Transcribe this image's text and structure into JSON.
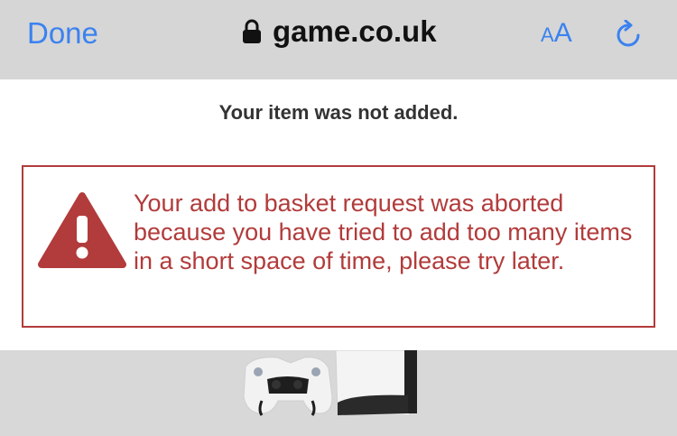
{
  "toolbar": {
    "done_label": "Done",
    "domain": "game.co.uk",
    "text_size_small": "A",
    "text_size_big": "A"
  },
  "page": {
    "heading": "Your item was not added.",
    "alert_message": "Your add to basket request was aborted because you have tried to add too many items in a short space of time, please try later."
  },
  "colors": {
    "link_blue": "#3b82f0",
    "alert_red": "#b23b3b",
    "toolbar_bg": "#d6d6d6"
  },
  "icons": [
    "lock-icon",
    "reload-icon",
    "warning-icon"
  ]
}
